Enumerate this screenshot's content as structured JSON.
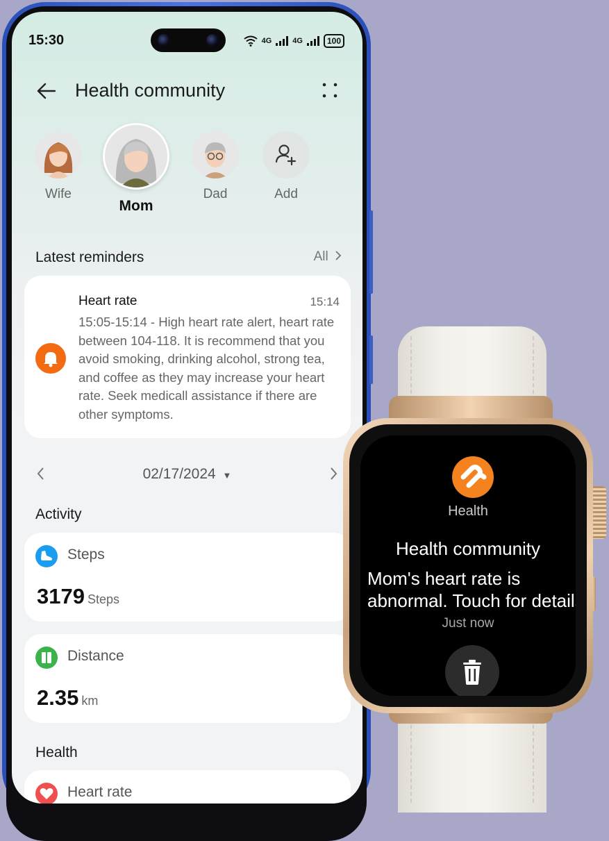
{
  "status_bar": {
    "time": "15:30",
    "network_1": "4G",
    "network_2": "4G",
    "battery": "100"
  },
  "header": {
    "title": "Health community"
  },
  "members": [
    {
      "label": "Wife",
      "selected": false
    },
    {
      "label": "Mom",
      "selected": true
    },
    {
      "label": "Dad",
      "selected": false
    },
    {
      "label": "Add",
      "selected": false
    }
  ],
  "reminders": {
    "section_title": "Latest reminders",
    "all_link": "All",
    "card": {
      "title": "Heart rate",
      "time": "15:14",
      "body": "15:05-15:14 - High heart rate alert, heart rate between 104-118. It is recommend that you avoid smoking, drinking alcohol, strong tea, and coffee as they may increase your heart rate. Seek medicall assistance if there are other symptoms."
    }
  },
  "date_nav": {
    "date": "02/17/2024"
  },
  "activity": {
    "section_title": "Activity",
    "steps": {
      "name": "Steps",
      "value": "3179",
      "unit": "Steps"
    },
    "distance": {
      "name": "Distance",
      "value": "2.35",
      "unit": "km"
    }
  },
  "health": {
    "section_title": "Health",
    "heart_rate": {
      "name": "Heart rate"
    }
  },
  "watch": {
    "app_name": "Health",
    "title": "Health community",
    "message": "Mom's heart rate is abnormal. Touch for details.",
    "time": "Just now"
  },
  "colors": {
    "reminder_icon": "#f26a12",
    "steps_icon": "#1a9cf0",
    "distance_icon": "#3bb24a",
    "heart_icon": "#ef4f4f",
    "watch_logo": "#f3821f"
  }
}
